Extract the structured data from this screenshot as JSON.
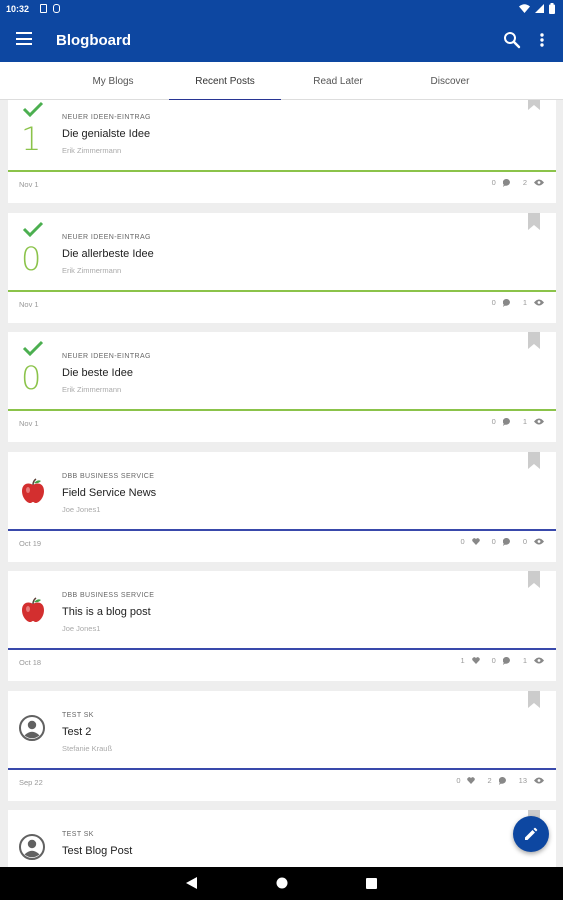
{
  "status_bar": {
    "time": "10:32"
  },
  "app_bar": {
    "title": "Blogboard"
  },
  "tabs": [
    {
      "label": "My Blogs",
      "active": false
    },
    {
      "label": "Recent Posts",
      "active": true
    },
    {
      "label": "Read Later",
      "active": false
    },
    {
      "label": "Discover",
      "active": false
    }
  ],
  "colors": {
    "primary": "#0d47a1",
    "green": "#4caf50",
    "idea_green": "#8bc34a",
    "blue_divider": "#3949ab"
  },
  "posts": [
    {
      "category": "NEUER IDEEN-EINTRAG",
      "title": "Die genialste Idee",
      "author": "Erik Zimmermann",
      "date": "Nov 1",
      "badge": "1",
      "avatar": "check-icon",
      "divider": "green",
      "likes": null,
      "comments": "0",
      "views": "2"
    },
    {
      "category": "NEUER IDEEN-EINTRAG",
      "title": "Die allerbeste Idee",
      "author": "Erik Zimmermann",
      "date": "Nov 1",
      "badge": "0",
      "avatar": "check-icon",
      "divider": "green",
      "likes": null,
      "comments": "0",
      "views": "1"
    },
    {
      "category": "NEUER IDEEN-EINTRAG",
      "title": "Die beste Idee",
      "author": "Erik Zimmermann",
      "date": "Nov 1",
      "badge": "0",
      "avatar": "check-icon",
      "divider": "green",
      "likes": null,
      "comments": "0",
      "views": "1"
    },
    {
      "category": "DBB BUSINESS SERVICE",
      "title": "Field Service News",
      "author": "Joe Jones1",
      "date": "Oct 19",
      "badge": null,
      "avatar": "apple-icon",
      "divider": "blue",
      "likes": "0",
      "comments": "0",
      "views": "0"
    },
    {
      "category": "DBB BUSINESS SERVICE",
      "title": "This is a blog post",
      "author": "Joe Jones1",
      "date": "Oct 18",
      "badge": null,
      "avatar": "apple-icon",
      "divider": "blue",
      "likes": "1",
      "comments": "0",
      "views": "1"
    },
    {
      "category": "TEST SK",
      "title": "Test 2",
      "author": "Stefanie Krauß",
      "date": "Sep 22",
      "badge": null,
      "avatar": "person-icon",
      "divider": "blue",
      "likes": "0",
      "comments": "2",
      "views": "13"
    },
    {
      "category": "TEST SK",
      "title": "Test Blog Post",
      "author": "",
      "date": "",
      "badge": null,
      "avatar": "person-icon",
      "divider": "blue",
      "likes": null,
      "comments": null,
      "views": null
    }
  ]
}
